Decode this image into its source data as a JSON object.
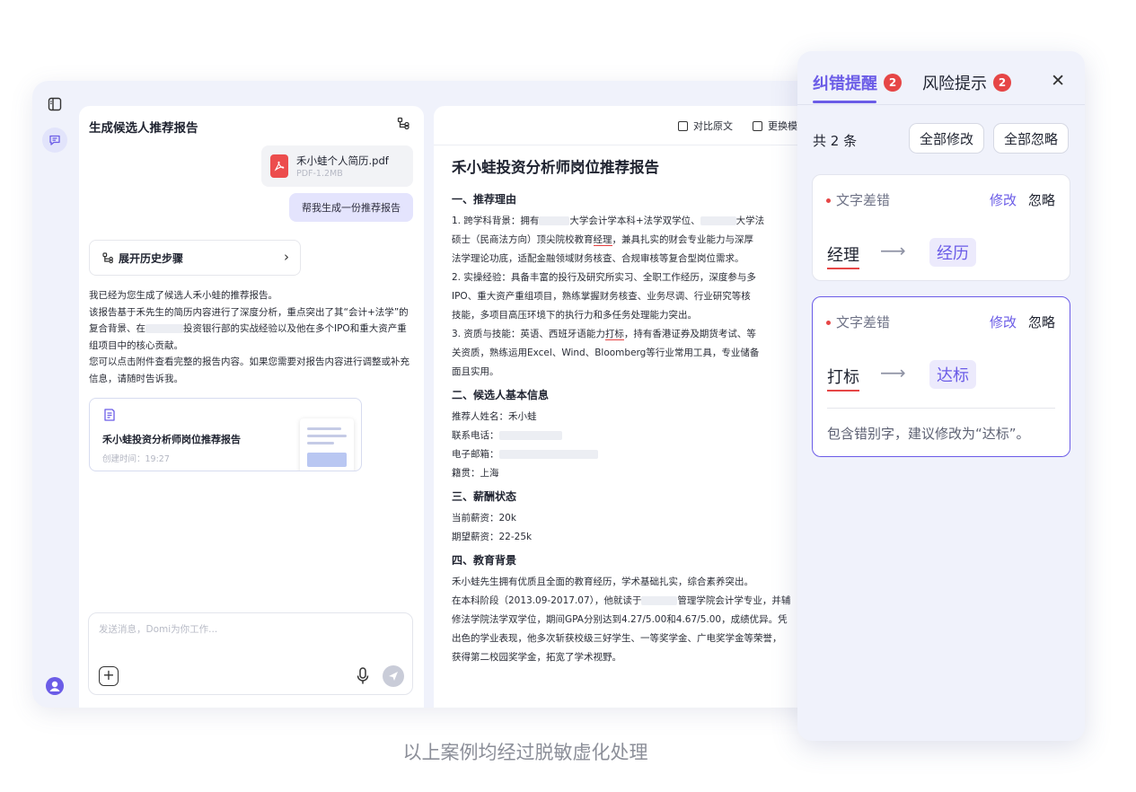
{
  "chat": {
    "title": "生成候选人推荐报告",
    "attachment": {
      "name": "禾小蛙个人简历.pdf",
      "meta": "PDF-1.2MB"
    },
    "user_message": "帮我生成一份推荐报告",
    "history_button": "展开历史步骤",
    "answer": {
      "line1": "我已经为您生成了候选人禾小蛙的推荐报告。",
      "line2a": "该报告基于禾先生的简历内容进行了深度分析，重点突出了其“会计+法学”的复合背景、在",
      "line2b": "投资银行部的实战经验以及他在多个IPO和重大资产重组项目中的核心贡献。",
      "line3": "您可以点击附件查看完整的报告内容。如果您需要对报告内容进行调整或补充信息，请随时告诉我。"
    },
    "report_card": {
      "title": "禾小蛙投资分析师岗位推荐报告",
      "meta": "创建时间：19:27"
    },
    "input": {
      "placeholder": "发送消息，Domi为你工作..."
    }
  },
  "toolbar": {
    "compare": "对比原文",
    "replace": "更换模"
  },
  "doc": {
    "title": "禾小蛙投资分析师岗位推荐报告",
    "s1": "一、推荐理由",
    "p1": {
      "a": "1. 跨学科背景：拥有",
      "b": "大学会计学本科+法学双学位、",
      "c": "大学法",
      "d": "硕士（民商法方向）顶尖院校教育",
      "e": "经理",
      "f": "，兼具扎实的财会专业能力与深厚",
      "g": "法学理论功底，适配金融领域财务核查、合规审核等复合型岗位需求。"
    },
    "p2": {
      "a": "2. 实操经验：具备丰富的投行及研究所实习、全职工作经历，深度参与多",
      "b": "IPO、重大资产重组项目，熟练掌握财务核查、业务尽调、行业研究等核",
      "c": "技能，多项目高压环境下的执行力和多任务处理能力突出。"
    },
    "p3": {
      "a": "3. 资质与技能：英语、西班牙语能力",
      "b": "打标",
      "c": "，持有香港证券及期货考试、等",
      "d": "关资质，熟练运用Excel、Wind、Bloomberg等行业常用工具，专业储备",
      "e": "面且实用。"
    },
    "s2": "二、候选人基本信息",
    "info": {
      "name": "推荐人姓名：禾小蛙",
      "phone": "联系电话：",
      "email": "电子邮箱：",
      "origin": "籍贯：上海"
    },
    "s3": "三、薪酬状态",
    "salary": {
      "current": "当前薪资：20k",
      "expected": "期望薪资：22-25k"
    },
    "s4": "四、教育背景",
    "edu": {
      "a": "禾小蛙先生拥有优质且全面的教育经历，学术基础扎实，综合素养突出。",
      "b1": "在本科阶段（2013.09-2017.07），他就读于",
      "b2": "管理学院会计学专业，并辅",
      "c": "修法学院法学双学位，期间GPA分别达到4.27/5.00和4.67/5.00，成绩优异。凭",
      "d": "出色的学业表现，他多次斩获校级三好学生、一等奖学金、广电奖学金等荣誉，",
      "e": "获得第二校园奖学金，拓宽了学术视野。"
    }
  },
  "proof": {
    "tab_errors": "纠错提醒",
    "tab_errors_count": "2",
    "tab_risk": "风险提示",
    "tab_risk_count": "2",
    "count_label": "共 2 条",
    "fix_all": "全部修改",
    "ignore_all": "全部忽略",
    "cards": [
      {
        "type": "文字差错",
        "fix": "修改",
        "ignore": "忽略",
        "wrong": "经理",
        "right": "经历"
      },
      {
        "type": "文字差错",
        "fix": "修改",
        "ignore": "忽略",
        "wrong": "打标",
        "right": "达标",
        "hint": "包含错别字，建议修改为“达标”。"
      }
    ]
  },
  "caption": "以上案例均经过脱敏虚化处理",
  "colors": {
    "accent": "#6b5ce7",
    "error": "#e64646",
    "panel_bg": "#f0f2fb"
  },
  "icons": [
    "sidebar-toggle-icon",
    "chat-icon",
    "user-avatar-icon",
    "flow-icon",
    "pdf-icon",
    "chevron-right-icon",
    "report-icon",
    "plus-icon",
    "mic-icon",
    "send-icon",
    "compare-icon",
    "template-icon",
    "close-icon",
    "arrow-right-icon"
  ]
}
